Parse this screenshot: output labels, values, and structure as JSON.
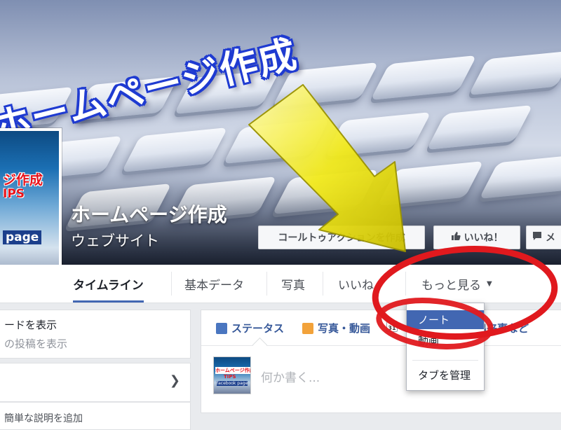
{
  "cover": {
    "title": "ホームページ作成"
  },
  "page": {
    "name": "ホームページ作成",
    "category": "ウェブサイト"
  },
  "profile_picture": {
    "line1": "ジ作成",
    "line2": "IPS",
    "line3": "page"
  },
  "cover_buttons": {
    "cta": "コールトゥアクションを作成",
    "like": "いいね！",
    "message": "メ"
  },
  "nav": {
    "tabs": [
      {
        "label": "タイムライン",
        "active": true
      },
      {
        "label": "基本データ"
      },
      {
        "label": "写真"
      },
      {
        "label": "いいね"
      },
      {
        "label": "もっと見る"
      }
    ]
  },
  "dropdown": {
    "items": [
      "ノート",
      "動画",
      "タブを管理"
    ],
    "selected": "ノート"
  },
  "left_column": {
    "line1": "ードを表示",
    "line2": "の投稿を表示",
    "line3": "簡単な説明を追加"
  },
  "composer": {
    "tabs": [
      "ステータス",
      "写真・動画",
      "出来事など"
    ],
    "calendar_day": "31",
    "placeholder": "何か書く...",
    "avatar_text": [
      "ホームページ作成",
      "TIPS",
      "facebook page"
    ]
  },
  "icons": {
    "like": "thumbs-up-icon",
    "message": "speech-bubble-icon",
    "dropdown_caret": "caret-down-icon",
    "chevron": "chevron-right-icon"
  },
  "colors": {
    "brand_blue": "#4267b2",
    "link_blue": "#365899",
    "annotation_red": "#e0191e",
    "arrow_yellow": "#f2ea1c"
  }
}
